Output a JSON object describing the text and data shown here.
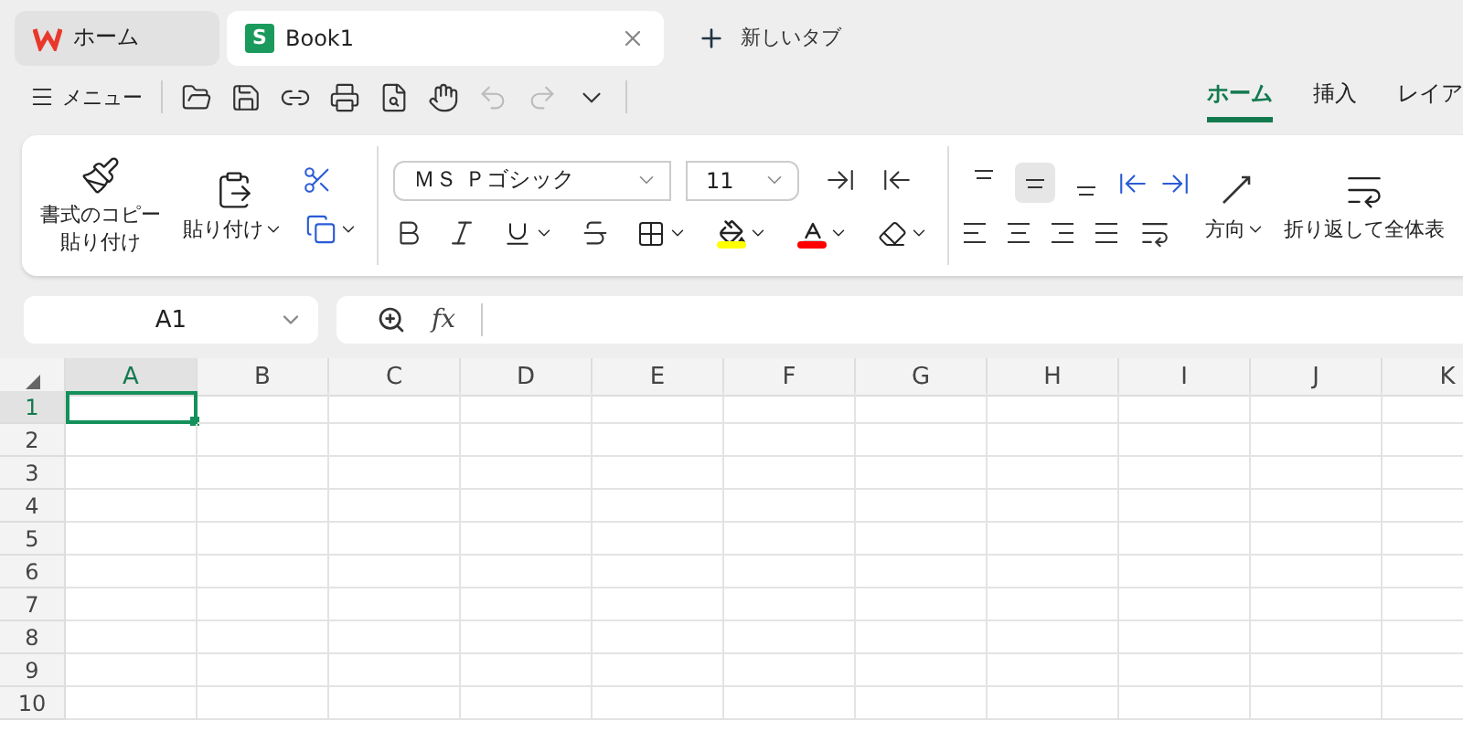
{
  "browser_tabs": [
    {
      "kind": "home",
      "label": "ホーム",
      "selected": false
    },
    {
      "kind": "sheet",
      "label": "Book1",
      "selected": true,
      "badge": "S"
    }
  ],
  "new_tab": {
    "label": "新しいタブ"
  },
  "menu": {
    "label": "メニュー"
  },
  "quick_access": {
    "undo": {
      "disabled": true
    },
    "redo": {
      "disabled": true
    }
  },
  "ribbon_tabs": [
    {
      "label": "ホーム",
      "selected": true
    },
    {
      "label": "挿入",
      "selected": false
    },
    {
      "label": "レイア",
      "selected": false
    }
  ],
  "clipboard": {
    "format_painter": "書式のコピー貼り付け",
    "paste": "貼り付け"
  },
  "font": {
    "name": "ＭＳ Ｐゴシック",
    "size": "11"
  },
  "alignment": {
    "vertical": [
      {
        "selected": false
      },
      {
        "selected": true
      },
      {
        "selected": false
      }
    ],
    "orientation": "方向",
    "wrap": "折り返して全体表"
  },
  "name_box": "A1",
  "formula_bar": {
    "fx": "fx"
  },
  "sheet": {
    "columns": [
      {
        "label": "A",
        "selected": true
      },
      {
        "label": "B",
        "selected": false
      },
      {
        "label": "C",
        "selected": false
      },
      {
        "label": "D",
        "selected": false
      },
      {
        "label": "E",
        "selected": false
      },
      {
        "label": "F",
        "selected": false
      },
      {
        "label": "G",
        "selected": false
      },
      {
        "label": "H",
        "selected": false
      },
      {
        "label": "I",
        "selected": false
      },
      {
        "label": "J",
        "selected": false
      },
      {
        "label": "K",
        "selected": false
      }
    ],
    "rows": [
      {
        "label": "1",
        "selected": true
      },
      {
        "label": "2",
        "selected": false
      },
      {
        "label": "3",
        "selected": false
      },
      {
        "label": "4",
        "selected": false
      },
      {
        "label": "5",
        "selected": false
      },
      {
        "label": "6",
        "selected": false
      },
      {
        "label": "7",
        "selected": false
      },
      {
        "label": "8",
        "selected": false
      },
      {
        "label": "9",
        "selected": false
      },
      {
        "label": "10",
        "selected": false
      }
    ]
  }
}
